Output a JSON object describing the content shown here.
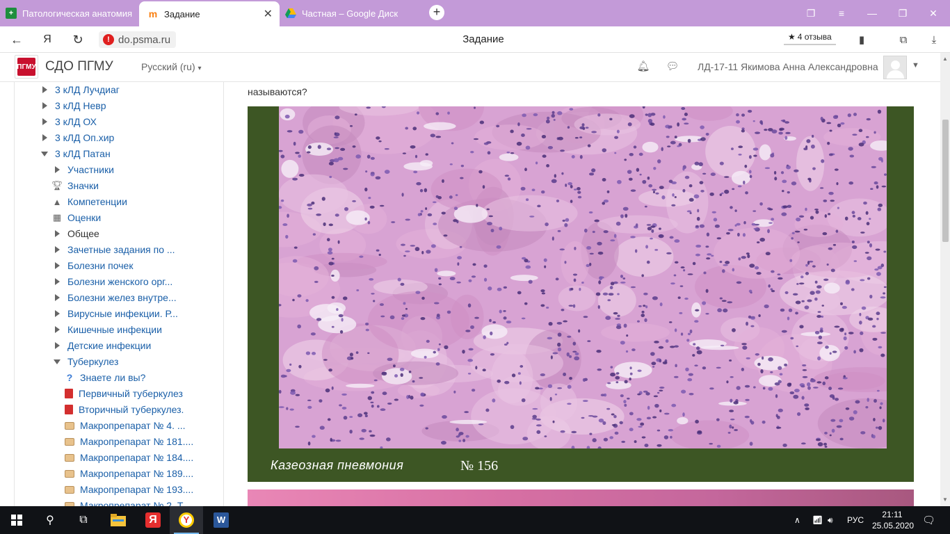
{
  "browser": {
    "tabs": [
      {
        "title": "Патологическая анатомия",
        "favicon": "green-plus-icon"
      },
      {
        "title": "Задание",
        "favicon": "moodle-icon",
        "active": true
      },
      {
        "title": "Частная – Google Диск",
        "favicon": "google-drive-icon"
      }
    ],
    "url": "do.psma.ru",
    "page_title": "Задание",
    "reviews": "4 отзыва"
  },
  "header": {
    "site_name": "СДО ПГМУ",
    "language": "Русский (ru)",
    "user_name": "ЛД-17-11 Якимова Анна Александровна"
  },
  "nav": {
    "items": [
      {
        "label": "3 кЛД Лучдиаг"
      },
      {
        "label": "3 кЛД Невр"
      },
      {
        "label": "3 кЛД ОХ"
      },
      {
        "label": "3 кЛД Оп.хир"
      },
      {
        "label": "3 кЛД Патан"
      },
      {
        "label": "Участники"
      },
      {
        "label": "Значки"
      },
      {
        "label": "Компетенции"
      },
      {
        "label": "Оценки"
      },
      {
        "label": "Общее"
      },
      {
        "label": "Зачетные задания по ..."
      },
      {
        "label": "Болезни почек"
      },
      {
        "label": "Болезни женского орг..."
      },
      {
        "label": "Болезни желез внутре..."
      },
      {
        "label": "Вирусные инфекции. Р..."
      },
      {
        "label": "Кишечные инфекции"
      },
      {
        "label": "Детские инфекции"
      },
      {
        "label": "Туберкулез"
      },
      {
        "label": "Знаете ли вы?"
      },
      {
        "label": "Первичный туберкулез"
      },
      {
        "label": "Вторичный туберкулез."
      },
      {
        "label": "Макропрепарат № 4. ..."
      },
      {
        "label": "Макропрепарат № 181...."
      },
      {
        "label": "Макропрепарат № 184...."
      },
      {
        "label": "Макропрепарат № 189...."
      },
      {
        "label": "Макропрепарат № 193...."
      },
      {
        "label": "Макропрепарат № 2. Т..."
      }
    ]
  },
  "main": {
    "question_tail": "называются?",
    "figure_caption": "Казеозная пневмония",
    "figure_number": "№ 156"
  },
  "taskbar": {
    "lang": "РУС",
    "time": "21:11",
    "date": "25.05.2020"
  },
  "colors": {
    "tabbar": "#c39ad8",
    "link": "#1a5fa8",
    "figure_frame": "#3d5624",
    "stain": "#d8a3d3"
  }
}
